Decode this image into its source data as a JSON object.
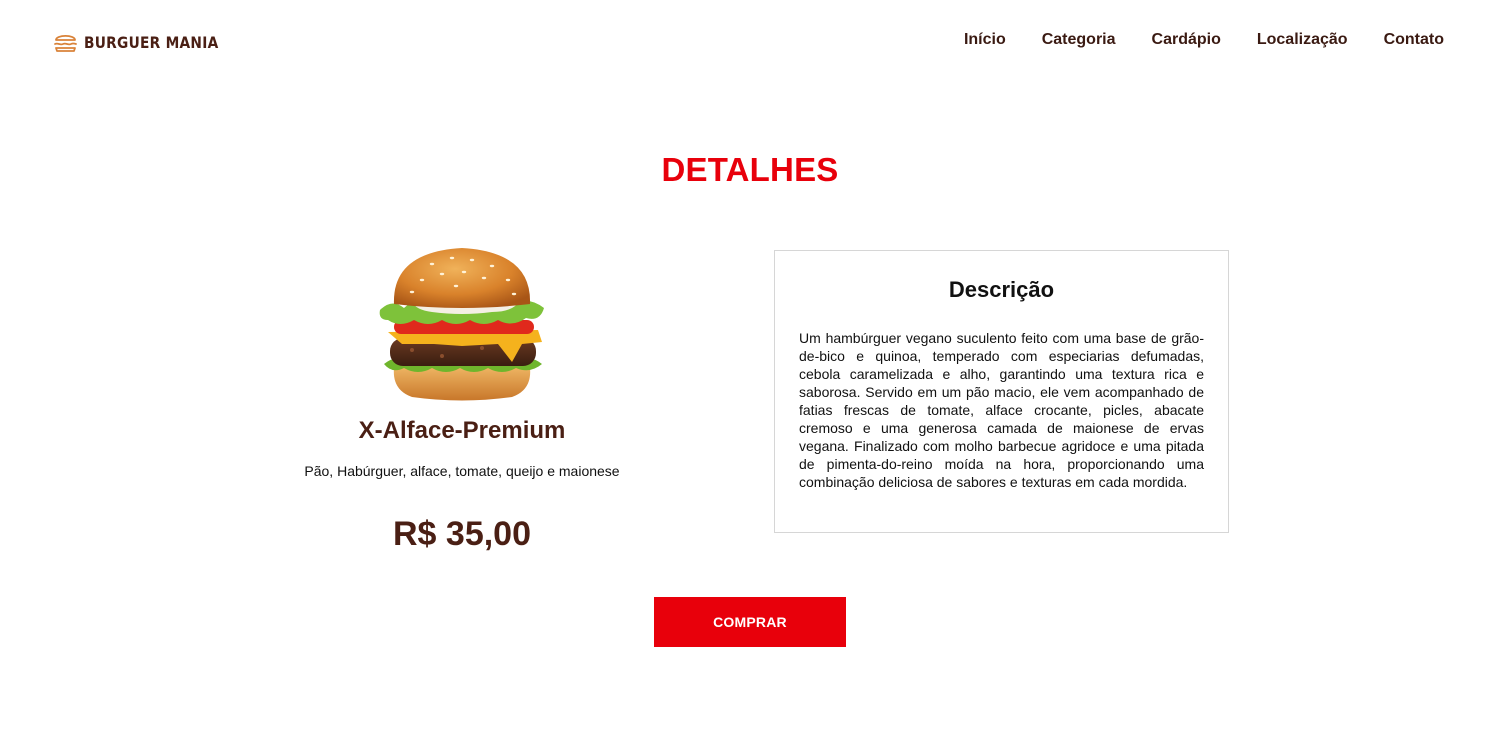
{
  "brand": {
    "name": "BURGUER MANIA",
    "icon": "burger-icon",
    "color": "#4a1f14"
  },
  "nav": {
    "items": [
      "Início",
      "Categoria",
      "Cardápio",
      "Localização",
      "Contato"
    ]
  },
  "section": {
    "title": "DETALHES",
    "title_color": "#e8000b"
  },
  "product": {
    "image": "burger-image",
    "name": "X-Alface-Premium",
    "ingredients": "Pão, Habúrguer, alface, tomate, queijo e maionese",
    "price": "R$ 35,00"
  },
  "description": {
    "title": "Descrição",
    "text": "Um hambúrguer vegano suculento feito com uma base de grão-de-bico e quinoa, temperado com especiarias defumadas, cebola caramelizada e alho, garantindo uma textura rica e saborosa. Servido em um pão macio, ele vem acompanhado de fatias frescas de tomate, alface crocante, picles, abacate cremoso e uma generosa camada de maionese de ervas vegana. Finalizado com molho barbecue agridoce e uma pitada de pimenta-do-reino moída na hora, proporcionando uma combinação deliciosa de sabores e texturas em cada mordida."
  },
  "actions": {
    "buy_label": "COMPRAR",
    "buy_color": "#e8000b"
  }
}
